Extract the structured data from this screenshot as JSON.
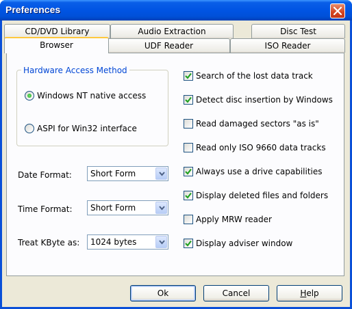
{
  "window": {
    "title": "Preferences"
  },
  "tabs": {
    "row1": [
      {
        "label": "CD/DVD Library"
      },
      {
        "label": "Audio Extraction"
      },
      {
        "label": "Disc Test"
      }
    ],
    "row2": [
      {
        "label": "Browser",
        "active": true
      },
      {
        "label": "UDF Reader"
      },
      {
        "label": "ISO Reader"
      }
    ]
  },
  "hardware": {
    "title": "Hardware Access Method",
    "options": [
      {
        "label": "Windows NT native access",
        "checked": true
      },
      {
        "label": "ASPI for Win32 interface",
        "checked": false
      }
    ]
  },
  "fields": {
    "date_format": {
      "label": "Date Format:",
      "value": "Short Form"
    },
    "time_format": {
      "label": "Time Format:",
      "value": "Short Form"
    },
    "kbyte": {
      "label": "Treat KByte as:",
      "value": "1024 bytes"
    }
  },
  "checkboxes": [
    {
      "label": "Search of the lost data track",
      "checked": true
    },
    {
      "label": "Detect disc insertion by Windows",
      "checked": true
    },
    {
      "label": "Read damaged sectors \"as is\"",
      "checked": false
    },
    {
      "label": "Read only ISO 9660 data tracks",
      "checked": false
    },
    {
      "label": "Always use a drive capabilities",
      "checked": true
    },
    {
      "label": "Display deleted files and folders",
      "checked": true
    },
    {
      "label": "Apply MRW reader",
      "checked": false
    },
    {
      "label": "Display adviser window",
      "checked": true
    }
  ],
  "buttons": {
    "ok": "Ok",
    "cancel": "Cancel",
    "help_underlined": "H",
    "help_rest": "elp"
  }
}
